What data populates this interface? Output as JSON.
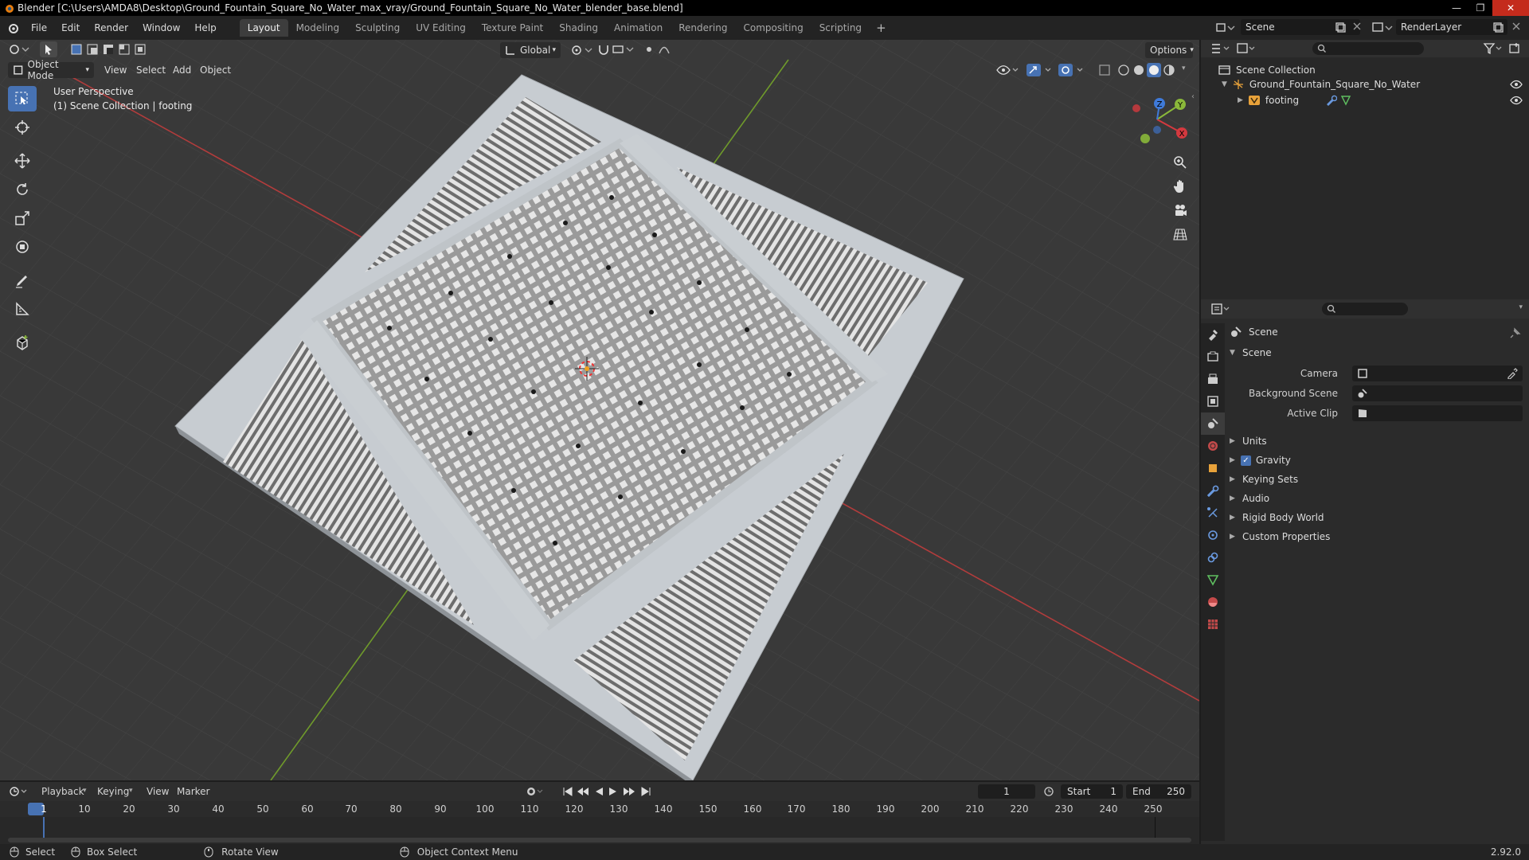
{
  "window": {
    "title": "Blender [C:\\Users\\AMDA8\\Desktop\\Ground_Fountain_Square_No_Water_max_vray/Ground_Fountain_Square_No_Water_blender_base.blend]"
  },
  "menu": {
    "items": [
      "File",
      "Edit",
      "Render",
      "Window",
      "Help"
    ]
  },
  "workspaces": {
    "tabs": [
      "Layout",
      "Modeling",
      "Sculpting",
      "UV Editing",
      "Texture Paint",
      "Shading",
      "Animation",
      "Rendering",
      "Compositing",
      "Scripting"
    ],
    "active": "Layout",
    "add": "+"
  },
  "scene_selector": {
    "value": "Scene"
  },
  "render_layer": {
    "value": "RenderLayer"
  },
  "viewport": {
    "transform_orientation": "Global",
    "options_label": "Options",
    "mode": "Object Mode",
    "header_menus": [
      "View",
      "Select",
      "Add",
      "Object"
    ],
    "info_line1": "User Perspective",
    "info_line2": "(1) Scene Collection | footing",
    "gizmo": {
      "x": "X",
      "y": "Y",
      "z": "Z"
    }
  },
  "outliner": {
    "root": "Scene Collection",
    "items": [
      {
        "label": "Ground_Fountain_Square_No_Water",
        "expanded": true
      },
      {
        "label": "footing",
        "expanded": false
      }
    ]
  },
  "properties": {
    "context_label": "Scene",
    "panel_title": "Scene",
    "fields": [
      {
        "label": "Camera",
        "value": ""
      },
      {
        "label": "Background Scene",
        "value": ""
      },
      {
        "label": "Active Clip",
        "value": ""
      }
    ],
    "sections": [
      {
        "label": "Units",
        "checkbox": false
      },
      {
        "label": "Gravity",
        "checkbox": true,
        "checked": true
      },
      {
        "label": "Keying Sets",
        "checkbox": false
      },
      {
        "label": "Audio",
        "checkbox": false
      },
      {
        "label": "Rigid Body World",
        "checkbox": false
      },
      {
        "label": "Custom Properties",
        "checkbox": false
      }
    ]
  },
  "timeline": {
    "menus": [
      "Playback",
      "Keying",
      "View",
      "Marker"
    ],
    "current_frame": "1",
    "start_label": "Start",
    "start": "1",
    "end_label": "End",
    "end": "250",
    "ruler": [
      "1",
      "10",
      "20",
      "30",
      "40",
      "50",
      "60",
      "70",
      "80",
      "90",
      "100",
      "110",
      "120",
      "130",
      "140",
      "150",
      "160",
      "170",
      "180",
      "190",
      "200",
      "210",
      "220",
      "230",
      "240",
      "250"
    ]
  },
  "statusbar": {
    "select": "Select",
    "box_select": "Box Select",
    "rotate_view": "Rotate View",
    "context_menu": "Object Context Menu",
    "version": "2.92.0"
  },
  "colors": {
    "accent": "#4772b3",
    "x_axis": "#d4393f",
    "y_axis": "#8ab83a",
    "z_axis": "#3f7ad9",
    "close_button": "#c42b1c"
  }
}
